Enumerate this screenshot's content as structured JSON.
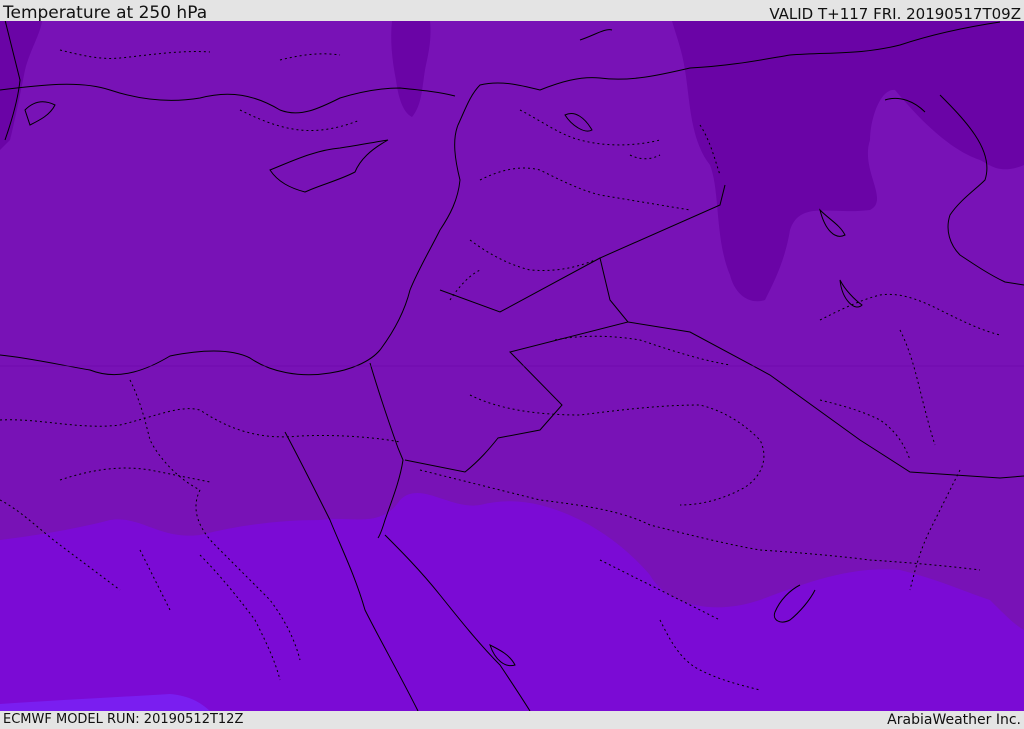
{
  "header": {
    "title": "Temperature at 250 hPa",
    "valid": "VALID T+117 FRI. 20190517T09Z"
  },
  "footer": {
    "model_run": "ECMWF MODEL RUN: 20190512T12Z",
    "credit": "ArabiaWeather Inc."
  },
  "colors": {
    "band_cold": "#6a04a6",
    "band_mid": "#7812b6",
    "band_warm": "#7b0bd5",
    "band_warmest": "#7a1ef0",
    "coast": "#000000",
    "bar_background": "#e4e4e4"
  }
}
